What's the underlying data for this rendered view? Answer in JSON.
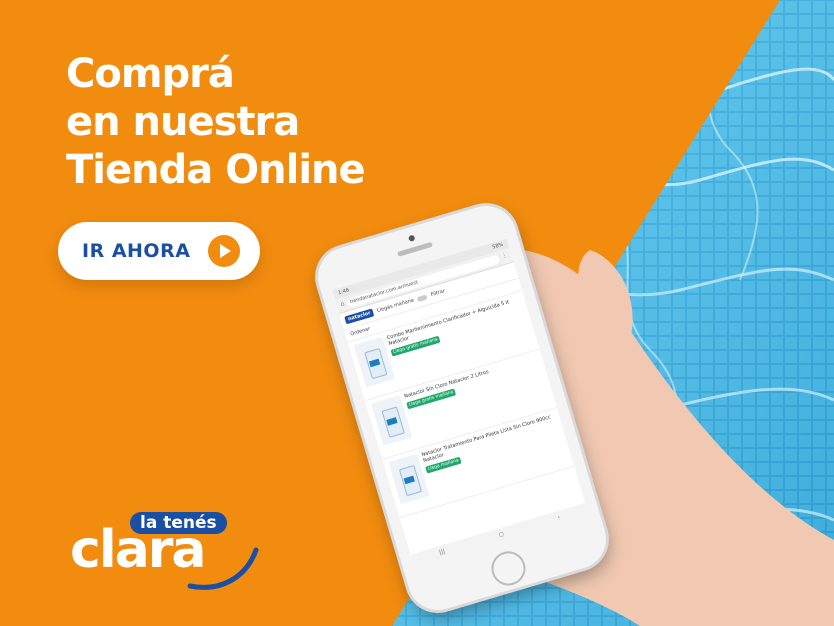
{
  "headline": {
    "line1": "Comprá",
    "line2": "en nuestra",
    "line3": "Tienda Online"
  },
  "cta": {
    "label": "IR AHORA",
    "icon": "play-circle-icon"
  },
  "logo": {
    "tagline": "la tenés",
    "word": "clara"
  },
  "colors": {
    "brand_orange": "#f28c0f",
    "brand_blue": "#1b4fa3",
    "pool_blue": "#3fb8e3",
    "badge_green": "#1fa86a"
  },
  "phone": {
    "status_time": "1:46",
    "status_battery": "58%",
    "url": "tiendanataclor.com.ar/nuest",
    "site_logo": "nataclor",
    "delivery_label": "Llegás mañana",
    "filter_label": "Filtrar",
    "order_label": "Ordenar",
    "products": [
      {
        "name": "Combo Mantenimiento Clarificador + Alguicida 5 lt Nataclor",
        "badge": "Llega gratis mañana"
      },
      {
        "name": "Nataclor Sin Cloro Nataclor 2 Litros",
        "badge": "Llega gratis mañana"
      },
      {
        "name": "Nataclor Tratamiento Para Pileta Lista Sin Cloro 900cc Nataclor",
        "badge": "Llega mañana"
      }
    ]
  }
}
